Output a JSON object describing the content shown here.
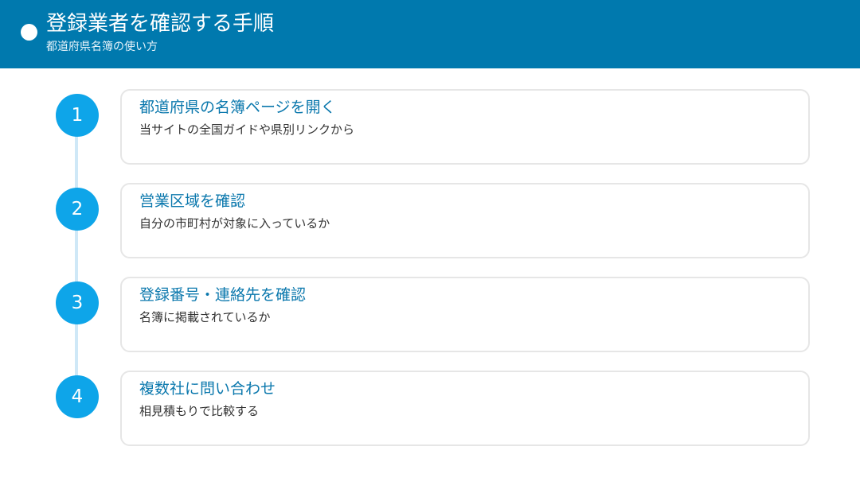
{
  "header": {
    "title": "登録業者を確認する手順",
    "subtitle": "都道府県名簿の使い方"
  },
  "steps": [
    {
      "number": "1",
      "title": "都道府県の名簿ページを開く",
      "description": "当サイトの全国ガイドや県別リンクから"
    },
    {
      "number": "2",
      "title": "営業区域を確認",
      "description": "自分の市町村が対象に入っているか"
    },
    {
      "number": "3",
      "title": "登録番号・連絡先を確認",
      "description": "名簿に掲載されているか"
    },
    {
      "number": "4",
      "title": "複数社に問い合わせ",
      "description": "相見積もりで比較する"
    }
  ],
  "colors": {
    "header_bg": "#0079ae",
    "accent": "#0ea5e9",
    "title_text": "#0b78ad",
    "timeline": "#cfe8f7"
  }
}
